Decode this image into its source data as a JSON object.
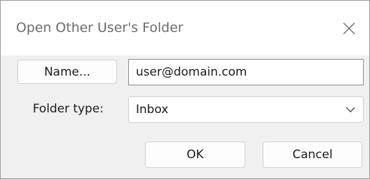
{
  "dialog": {
    "title": "Open Other User's Folder",
    "close_icon": "close-icon"
  },
  "name_button": {
    "label": "Name..."
  },
  "user_field": {
    "value": "user@domain.com"
  },
  "folder_type": {
    "label": "Folder type:",
    "selected": "Inbox",
    "icon": "chevron-down-icon"
  },
  "buttons": {
    "ok": "OK",
    "cancel": "Cancel"
  },
  "colors": {
    "dialog_background": "#f0f0f0",
    "title_text": "#6b6b6b"
  }
}
